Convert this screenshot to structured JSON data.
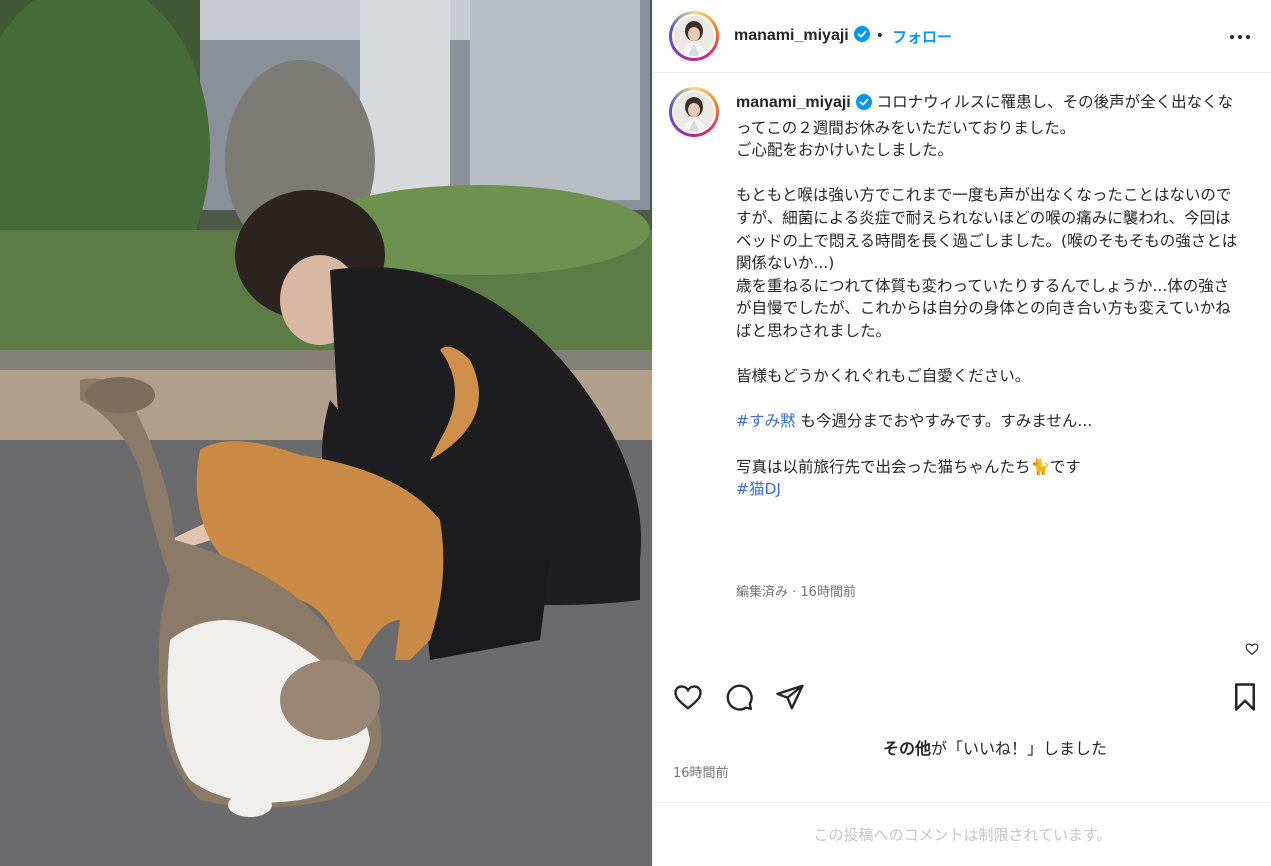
{
  "post": {
    "username": "manami_miyaji",
    "follow_label": "フォロー",
    "separator": "•",
    "photo_alt": "猫と女性の写真"
  },
  "caption": {
    "username": "manami_miyaji",
    "text_1": " コロナウィルスに罹患し、その後声が全く出なくなってこの２週間お休みをいただいておりました。\nご心配をおかけいたしました。\n\nもともと喉は強い方でこれまで一度も声が出なくなったことはないのですが、細菌による炎症で耐えられないほどの喉の痛みに襲われ、今回はベッドの上で悶える時間を長く過ごしました。(喉のそもそもの強さとは関係ないか...)\n歳を重ねるにつれて体質も変わっていたりするんでしょうか...体の強さが自慢でしたが、これからは自分の身体との向き合い方も変えていかねばと思わされました。\n\n皆様もどうかくれぐれもご自愛ください。\n\n",
    "hashtag_1": "#すみ黙",
    "text_2": " も今週分までおやすみです。すみません...\n\n写真は以前旅行先で出会った猫ちゃんたち🐈です\n",
    "hashtag_2": "#猫DJ",
    "meta": "編集済み · 16時間前"
  },
  "engagement": {
    "liked_by_suffix": "が「いいね！」しました",
    "liked_by_bold": "その他",
    "time": "16時間前"
  },
  "footer": {
    "comments_disabled": "この投稿へのコメントは制限されています。"
  },
  "icons": {
    "header_more": "more-horizontal-icon",
    "verified": "verified-badge-icon",
    "like": "heart-outline-icon",
    "comment": "comment-bubble-icon",
    "share": "paper-plane-icon",
    "save": "bookmark-icon",
    "comment_like": "small-heart-icon"
  },
  "colors": {
    "follow": "#0095f6",
    "verified": "#0095f6",
    "hashtag": "#3a6fd0",
    "muted": "#737373",
    "footer_text": "#c7c7c7"
  }
}
